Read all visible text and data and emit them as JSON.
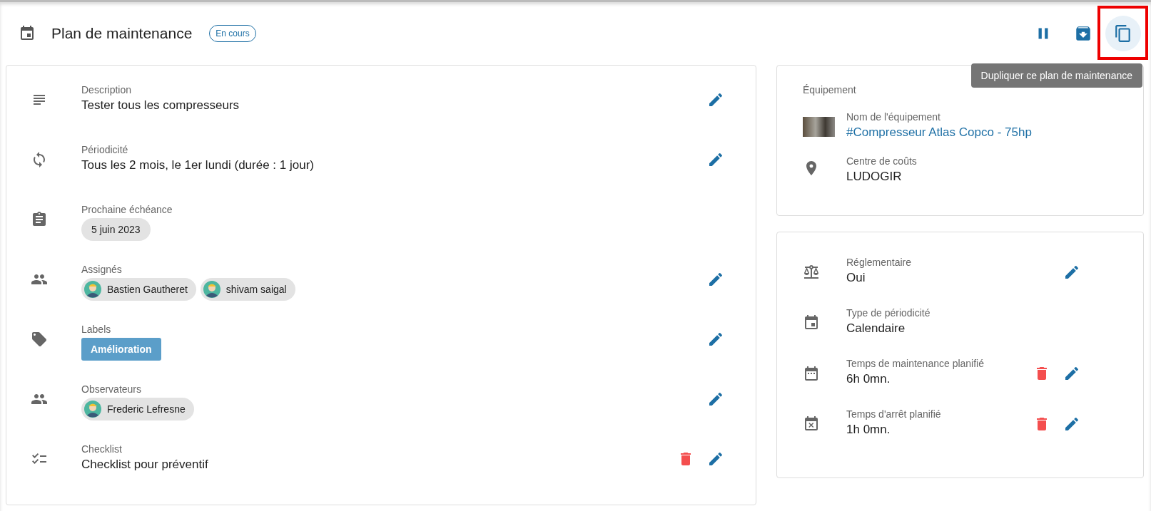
{
  "header": {
    "title": "Plan de maintenance",
    "status": "En cours"
  },
  "actions": [
    {
      "highlighted": false
    },
    {
      "highlighted": false
    },
    {
      "highlighted": true,
      "tooltip": "Dupliquer ce plan de maintenance"
    }
  ],
  "details": [
    {
      "kind": "text",
      "label": "Description",
      "value": "Tester tous les compresseurs",
      "editable": true,
      "deletable": false
    },
    {
      "kind": "text",
      "label": "Périodicité",
      "value": "Tous les 2 mois, le 1er lundi (durée : 1 jour)",
      "editable": true,
      "deletable": false
    },
    {
      "kind": "date",
      "label": "Prochaine échéance",
      "value": "5 juin 2023",
      "editable": false,
      "deletable": false
    },
    {
      "kind": "people",
      "label": "Assignés",
      "people": [
        "Bastien Gautheret",
        "shivam saigal"
      ],
      "editable": true,
      "deletable": false
    },
    {
      "kind": "tags",
      "label": "Labels",
      "tags": [
        {
          "text": "Amélioration",
          "color": "#5b9ec9"
        }
      ],
      "editable": true,
      "deletable": false
    },
    {
      "kind": "people",
      "label": "Observateurs",
      "people": [
        "Frederic Lefresne"
      ],
      "editable": true,
      "deletable": false
    },
    {
      "kind": "text",
      "label": "Checklist",
      "value": "Checklist pour préventif",
      "editable": true,
      "deletable": true
    }
  ],
  "equipment": {
    "title": "Équipement",
    "name_label": "Nom de l'équipement",
    "name": "#Compresseur Atlas Copco - 75hp",
    "cost_label": "Centre de coûts",
    "cost": "LUDOGIR"
  },
  "settings": [
    {
      "label": "Réglementaire",
      "value": "Oui",
      "editable": true,
      "deletable": false
    },
    {
      "label": "Type de périodicité",
      "value": "Calendaire",
      "editable": false,
      "deletable": false
    },
    {
      "label": "Temps de maintenance planifié",
      "value": "6h 0mn.",
      "editable": true,
      "deletable": true
    },
    {
      "label": "Temps d'arrêt planifié",
      "value": "1h 0mn.",
      "editable": true,
      "deletable": true
    }
  ]
}
